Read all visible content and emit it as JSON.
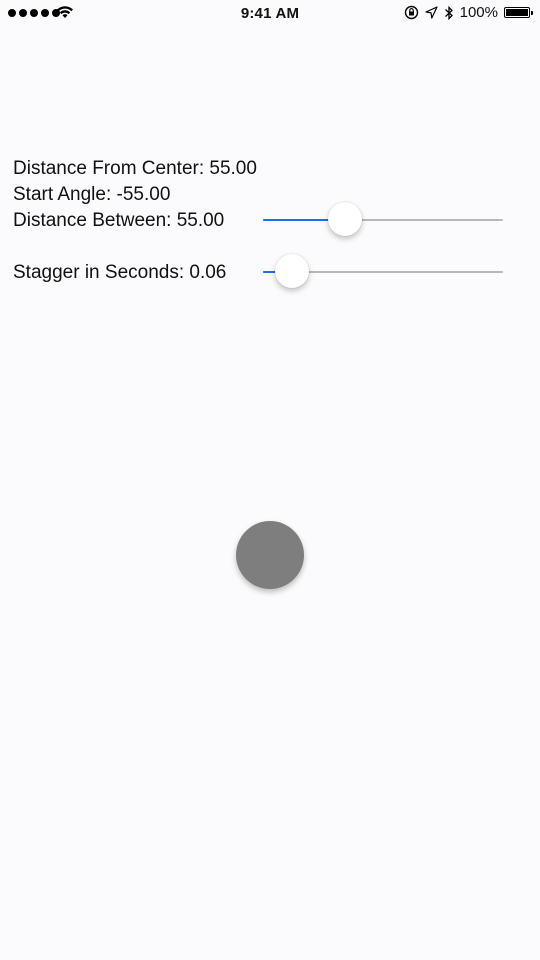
{
  "status_bar": {
    "time": "9:41 AM",
    "battery_percent": "100%",
    "battery_level": 1.0,
    "signal_bars": 5,
    "icons": [
      "signal-dots-icon",
      "wifi-icon",
      "orientation-lock-icon",
      "location-arrow-icon",
      "bluetooth-icon",
      "battery-icon"
    ]
  },
  "controls": {
    "distance_from_center_label": "Distance From Center: 55.00",
    "start_angle_label": "Start Angle: -55.00",
    "distance_between_label": "Distance Between: 55.00",
    "stagger_label": "Stagger in Seconds: 0.06",
    "distance_between_slider": {
      "value_fraction": 0.34
    },
    "stagger_slider": {
      "value_fraction": 0.12
    }
  },
  "colors": {
    "accent": "#1c6fe8",
    "track": "#b7b7b7",
    "center_button": "#7e7e7e",
    "background": "#fbfbfd"
  }
}
